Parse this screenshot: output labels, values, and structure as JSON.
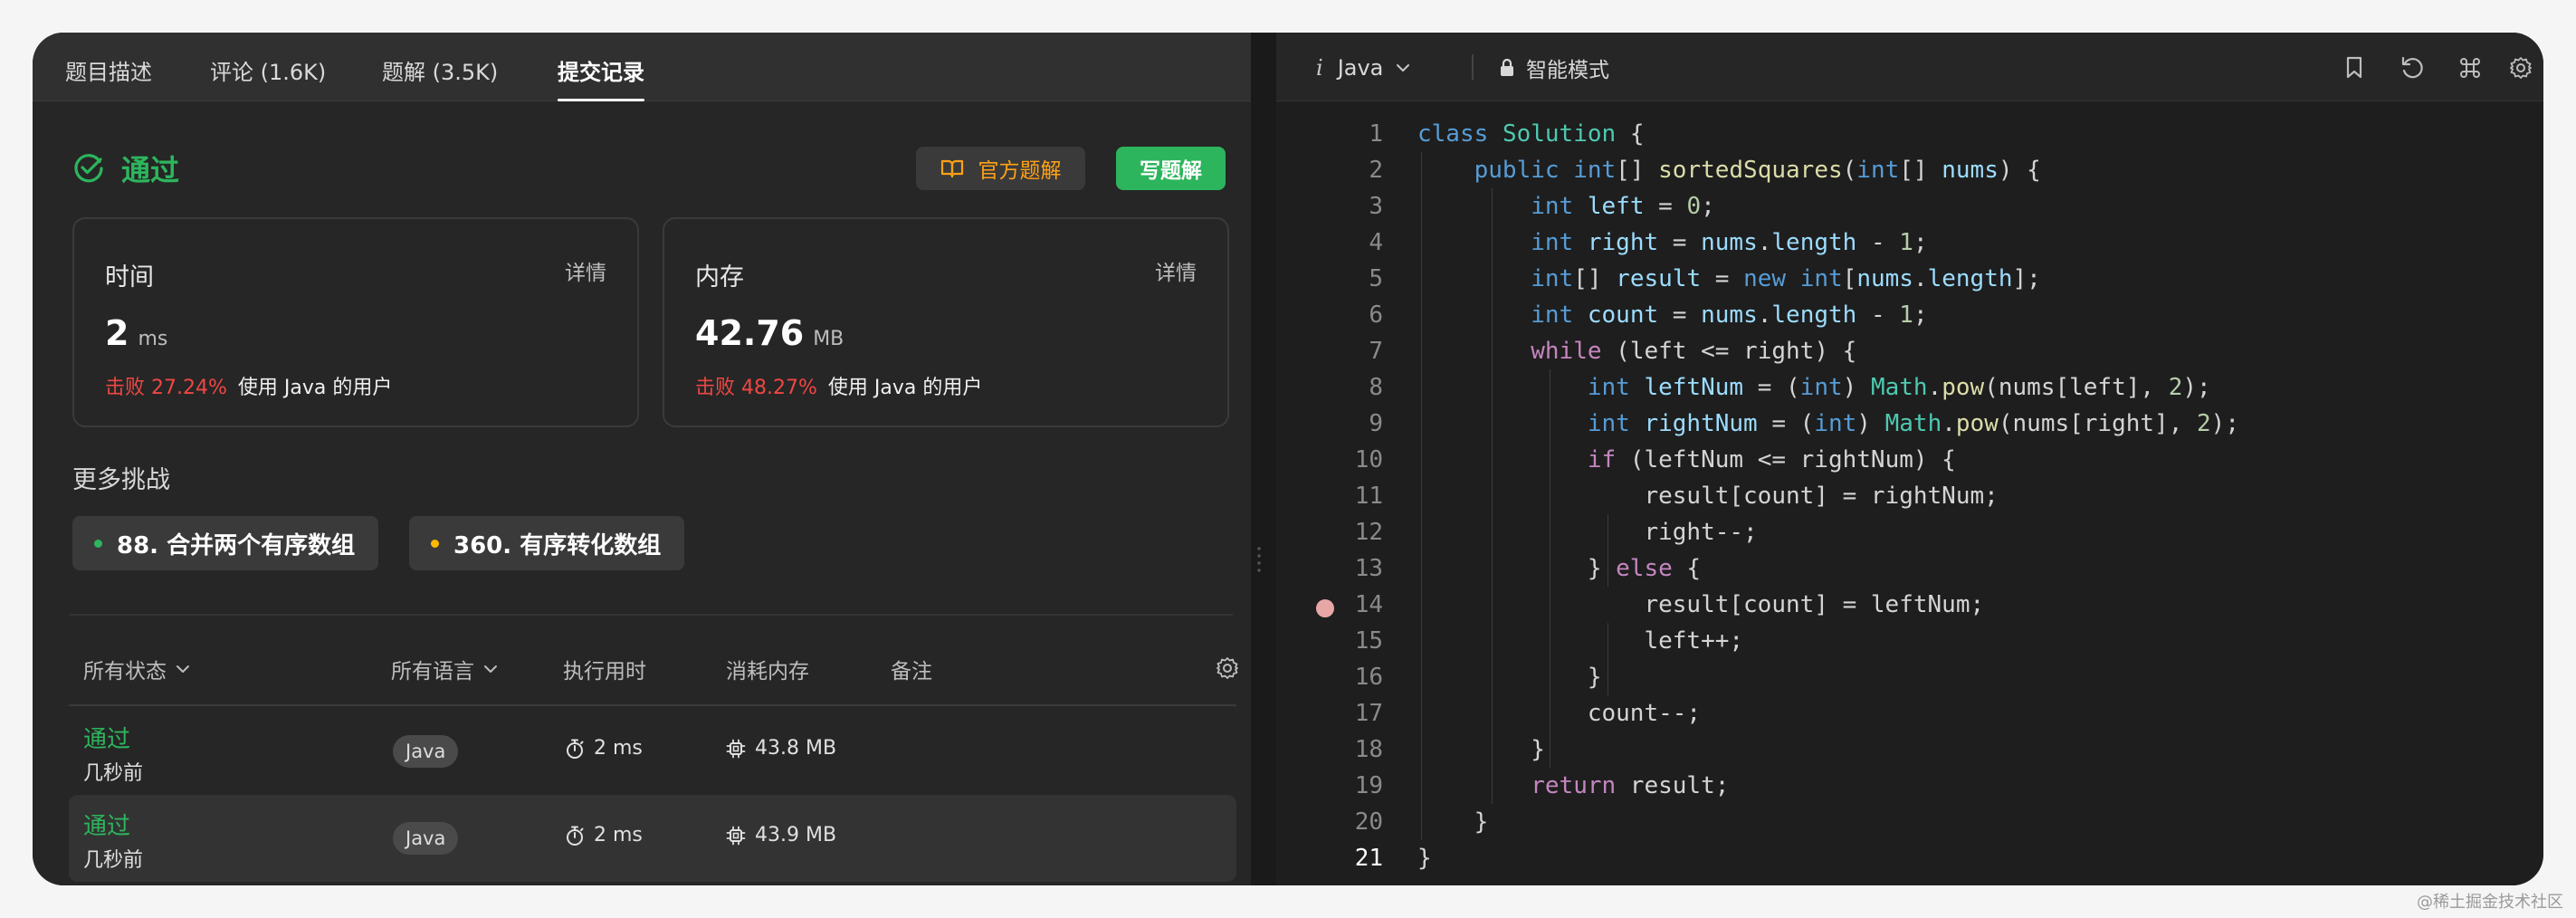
{
  "left_panel": {
    "tabs": [
      "题目描述",
      "评论 (1.6K)",
      "题解 (3.5K)",
      "提交记录"
    ],
    "status": "通过",
    "official_solution_label": "官方题解",
    "write_solution_label": "写题解",
    "cards": {
      "time": {
        "title": "时间",
        "detail": "详情",
        "value": "2",
        "unit": "ms",
        "beat": "击败 27.24%",
        "rest": "使用 Java 的用户"
      },
      "memory": {
        "title": "内存",
        "detail": "详情",
        "value": "42.76",
        "unit": "MB",
        "beat": "击败 48.27%",
        "rest": "使用 Java 的用户"
      }
    },
    "more_challenges_title": "更多挑战",
    "challenges": [
      {
        "label": "88. 合并两个有序数组",
        "dot_color": "#2db55d"
      },
      {
        "label": "360. 有序转化数组",
        "dot_color": "#ffb800"
      }
    ],
    "table_headers": {
      "status": "所有状态",
      "language": "所有语言",
      "runtime": "执行用时",
      "memory": "消耗内存",
      "notes": "备注"
    },
    "submissions": [
      {
        "status": "通过",
        "time": "几秒前",
        "language": "Java",
        "runtime": "2 ms",
        "memory": "43.8 MB"
      },
      {
        "status": "通过",
        "time": "几秒前",
        "language": "Java",
        "runtime": "2 ms",
        "memory": "43.9 MB"
      }
    ]
  },
  "editor": {
    "language_icon": "i",
    "language": "Java",
    "mode": "智能模式",
    "icons": [
      "bookmark-icon",
      "reset-icon",
      "command-icon",
      "settings-icon"
    ],
    "breakpoint_line": 14,
    "current_line": 21,
    "line_numbers": [
      "1",
      "2",
      "3",
      "4",
      "5",
      "6",
      "7",
      "8",
      "9",
      "10",
      "11",
      "12",
      "13",
      "14",
      "15",
      "16",
      "17",
      "18",
      "19",
      "20",
      "21"
    ]
  },
  "watermark": "@稀土掘金技术社区",
  "colors": {
    "accent_green": "#2db55d",
    "accent_orange": "#ffa116",
    "beat_red": "#ef4743"
  }
}
